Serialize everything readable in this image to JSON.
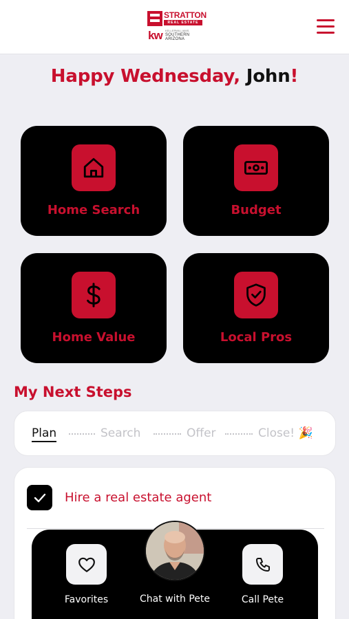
{
  "header": {
    "logo": {
      "brand": "STRATTON",
      "sub": "REAL ESTATE",
      "kw": "kw",
      "office_top": "KELLERWILLIAMS.",
      "office": "SOUTHERN ARIZONA"
    },
    "menu_icon": "hamburger-menu-icon"
  },
  "greeting": {
    "prefix": "Happy Wednesday, ",
    "name": "John",
    "suffix": "!"
  },
  "tiles": [
    {
      "label": "Home Search",
      "icon": "home-icon"
    },
    {
      "label": "Budget",
      "icon": "money-icon"
    },
    {
      "label": "Home Value",
      "icon": "dollar-icon"
    },
    {
      "label": "Local Pros",
      "icon": "shield-check-icon"
    }
  ],
  "next_steps": {
    "title": "My Next Steps",
    "steps": [
      "Plan",
      "Search",
      "Offer",
      "Close! 🎉"
    ],
    "active_step": "Plan"
  },
  "tasks": [
    {
      "label": "Hire a real estate agent",
      "checked": true
    }
  ],
  "bottom_bar": {
    "favorites": "Favorites",
    "chat": "Chat with Pete",
    "call": "Call Pete"
  },
  "colors": {
    "accent": "#c8102e",
    "tile_bg": "#000000",
    "page_bg": "#eeeef3"
  }
}
